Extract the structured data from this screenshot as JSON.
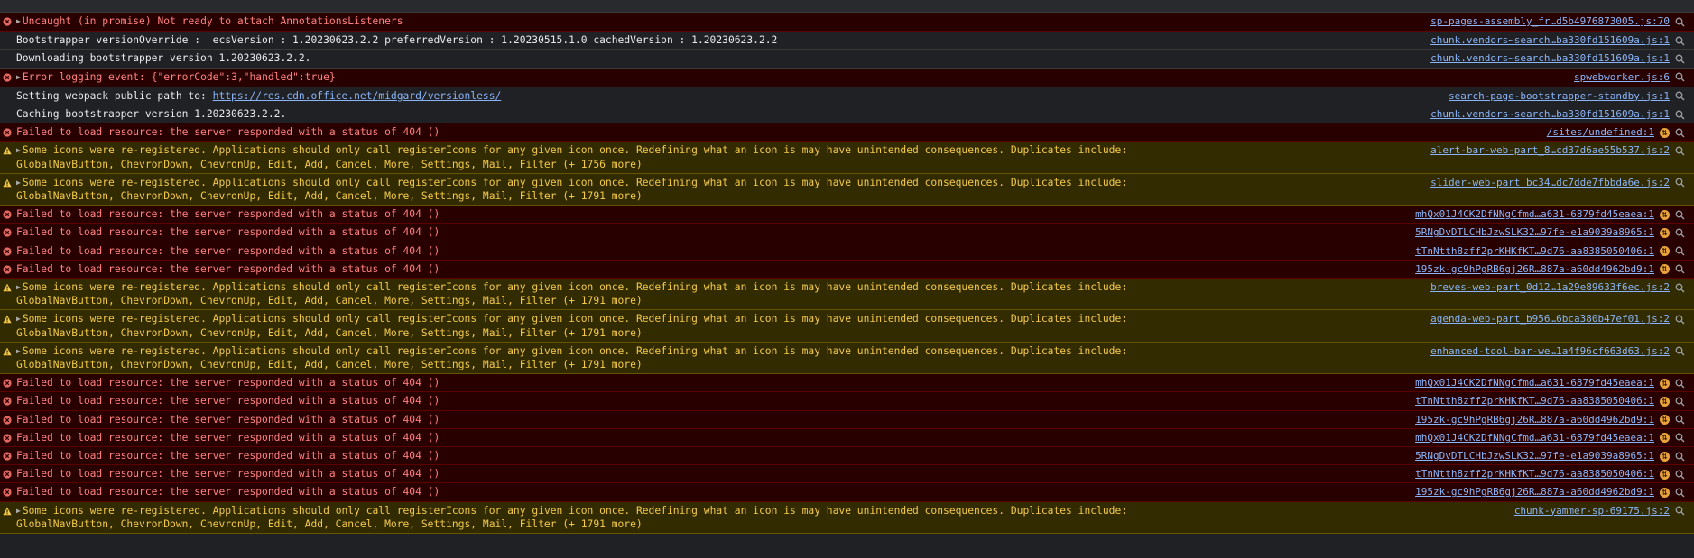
{
  "console": {
    "messages": [
      {
        "level": "error",
        "expandable": true,
        "text": "Uncaught (in promise) Not ready to attach AnnotationsListeners",
        "source": "sp-pages-assembly_fr…d5b4976873005.js:70",
        "network": false
      },
      {
        "level": "info",
        "expandable": false,
        "text": "Bootstrapper versionOverride :  ecsVersion : 1.20230623.2.2 preferredVersion : 1.20230515.1.0 cachedVersion : 1.20230623.2.2",
        "source": "chunk.vendors~search…ba330fd151609a.js:1",
        "network": false
      },
      {
        "level": "info",
        "expandable": false,
        "text": "Downloading bootstrapper version 1.20230623.2.2.",
        "source": "chunk.vendors~search…ba330fd151609a.js:1",
        "network": false
      },
      {
        "level": "error",
        "expandable": true,
        "text": "Error logging event: {\"errorCode\":3,\"handled\":true}",
        "source": "spwebworker.js:6",
        "network": false
      },
      {
        "level": "info",
        "expandable": false,
        "text": "Setting webpack public path to: ",
        "link": "https://res.cdn.office.net/midgard/versionless/",
        "source": "search-page-bootstrapper-standby.js:1",
        "network": false
      },
      {
        "level": "info",
        "expandable": false,
        "text": "Caching bootstrapper version 1.20230623.2.2.",
        "source": "chunk.vendors~search…ba330fd151609a.js:1",
        "network": false
      },
      {
        "level": "error",
        "expandable": false,
        "text": "Failed to load resource: the server responded with a status of 404 ()",
        "source": "/sites/undefined:1",
        "network": true
      },
      {
        "level": "warning",
        "expandable": true,
        "text": "Some icons were re-registered. Applications should only call registerIcons for any given icon once. Redefining what an icon is may have unintended consequences. Duplicates include:\nGlobalNavButton, ChevronDown, ChevronUp, Edit, Add, Cancel, More, Settings, Mail, Filter (+ 1756 more)",
        "source": "alert-bar-web-part_8…cd37d6ae55b537.js:2",
        "network": false
      },
      {
        "level": "warning",
        "expandable": true,
        "text": "Some icons were re-registered. Applications should only call registerIcons for any given icon once. Redefining what an icon is may have unintended consequences. Duplicates include:\nGlobalNavButton, ChevronDown, ChevronUp, Edit, Add, Cancel, More, Settings, Mail, Filter (+ 1791 more)",
        "source": "slider-web-part_bc34…dc7dde7fbbda6e.js:2",
        "network": false
      },
      {
        "level": "error",
        "expandable": false,
        "text": "Failed to load resource: the server responded with a status of 404 ()",
        "source": "mhQx01J4CK2DfNNgCfmd…a631-6879fd45eaea:1",
        "network": true
      },
      {
        "level": "error",
        "expandable": false,
        "text": "Failed to load resource: the server responded with a status of 404 ()",
        "source": "5RNgDvDTLCHbJzwSLK32…97fe-e1a9039a8965:1",
        "network": true
      },
      {
        "level": "error",
        "expandable": false,
        "text": "Failed to load resource: the server responded with a status of 404 ()",
        "source": "tTnNtth8zff2prKHKfKT…9d76-aa8385050406:1",
        "network": true
      },
      {
        "level": "error",
        "expandable": false,
        "text": "Failed to load resource: the server responded with a status of 404 ()",
        "source": "195zk-gc9hPgRB6gj26R…887a-a60dd4962bd9:1",
        "network": true
      },
      {
        "level": "warning",
        "expandable": true,
        "text": "Some icons were re-registered. Applications should only call registerIcons for any given icon once. Redefining what an icon is may have unintended consequences. Duplicates include:\nGlobalNavButton, ChevronDown, ChevronUp, Edit, Add, Cancel, More, Settings, Mail, Filter (+ 1791 more)",
        "source": "breves-web-part_0d12…1a29e89633f6ec.js:2",
        "network": false
      },
      {
        "level": "warning",
        "expandable": true,
        "text": "Some icons were re-registered. Applications should only call registerIcons for any given icon once. Redefining what an icon is may have unintended consequences. Duplicates include:\nGlobalNavButton, ChevronDown, ChevronUp, Edit, Add, Cancel, More, Settings, Mail, Filter (+ 1791 more)",
        "source": "agenda-web-part_b956…6bca380b47ef01.js:2",
        "network": false
      },
      {
        "level": "warning",
        "expandable": true,
        "text": "Some icons were re-registered. Applications should only call registerIcons for any given icon once. Redefining what an icon is may have unintended consequences. Duplicates include:\nGlobalNavButton, ChevronDown, ChevronUp, Edit, Add, Cancel, More, Settings, Mail, Filter (+ 1791 more)",
        "source": "enhanced-tool-bar-we…1a4f96cf663d63.js:2",
        "network": false
      },
      {
        "level": "error",
        "expandable": false,
        "text": "Failed to load resource: the server responded with a status of 404 ()",
        "source": "mhQx01J4CK2DfNNgCfmd…a631-6879fd45eaea:1",
        "network": true
      },
      {
        "level": "error",
        "expandable": false,
        "text": "Failed to load resource: the server responded with a status of 404 ()",
        "source": "tTnNtth8zff2prKHKfKT…9d76-aa8385050406:1",
        "network": true
      },
      {
        "level": "error",
        "expandable": false,
        "text": "Failed to load resource: the server responded with a status of 404 ()",
        "source": "195zk-gc9hPgRB6gj26R…887a-a60dd4962bd9:1",
        "network": true
      },
      {
        "level": "error",
        "expandable": false,
        "text": "Failed to load resource: the server responded with a status of 404 ()",
        "source": "mhQx01J4CK2DfNNgCfmd…a631-6879fd45eaea:1",
        "network": true
      },
      {
        "level": "error",
        "expandable": false,
        "text": "Failed to load resource: the server responded with a status of 404 ()",
        "source": "5RNgDvDTLCHbJzwSLK32…97fe-e1a9039a8965:1",
        "network": true
      },
      {
        "level": "error",
        "expandable": false,
        "text": "Failed to load resource: the server responded with a status of 404 ()",
        "source": "tTnNtth8zff2prKHKfKT…9d76-aa8385050406:1",
        "network": true
      },
      {
        "level": "error",
        "expandable": false,
        "text": "Failed to load resource: the server responded with a status of 404 ()",
        "source": "195zk-gc9hPgRB6gj26R…887a-a60dd4962bd9:1",
        "network": true
      },
      {
        "level": "warning",
        "expandable": true,
        "text": "Some icons were re-registered. Applications should only call registerIcons for any given icon once. Redefining what an icon is may have unintended consequences. Duplicates include:\nGlobalNavButton, ChevronDown, ChevronUp, Edit, Add, Cancel, More, Settings, Mail, Filter (+ 1791 more)",
        "source": "chunk-yammer-sp-69175.js:2",
        "network": false
      }
    ]
  },
  "icons": {
    "error": "error-circle-icon",
    "warning": "warning-triangle-icon",
    "network": "network-request-icon",
    "search": "search-icon",
    "expand": "expand-triangle-icon"
  },
  "colors": {
    "error_bg": "#290000",
    "error_text": "#ff8080",
    "warning_bg": "#332b00",
    "warning_text": "#f2c94c",
    "link": "#8ab4f8"
  }
}
